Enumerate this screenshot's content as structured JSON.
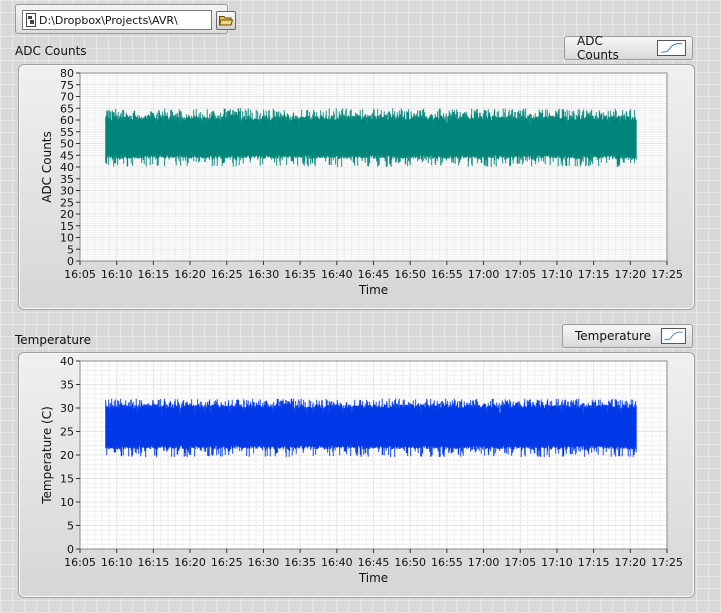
{
  "path": {
    "value": "D:\\Dropbox\\Projects\\AVR\\",
    "file_icon": "file-path-icon",
    "browse_icon": "folder-open-icon"
  },
  "colors": {
    "adc_series": "#00857a",
    "temp_series": "#0038e6",
    "plot_bg": "#ffffff",
    "grid": "#e4e4e4"
  },
  "chart_data": [
    {
      "type": "area",
      "title": "ADC Counts",
      "xlabel": "Time",
      "ylabel": "ADC Counts",
      "ylim": [
        0,
        80
      ],
      "yticks": [
        "0",
        "5",
        "10",
        "15",
        "20",
        "25",
        "30",
        "35",
        "40",
        "45",
        "50",
        "55",
        "60",
        "65",
        "70",
        "75",
        "80"
      ],
      "xticks": [
        "16:05",
        "16:10",
        "16:15",
        "16:20",
        "16:25",
        "16:30",
        "16:35",
        "16:40",
        "16:45",
        "16:50",
        "16:55",
        "17:00",
        "17:05",
        "17:10",
        "17:15",
        "17:20",
        "17:25"
      ],
      "xlim": [
        "16:05",
        "17:25"
      ],
      "grid": true,
      "legend": "top-right",
      "series": [
        {
          "name": "ADC Counts",
          "x_start": "16:08:30",
          "x_end": "17:20:50",
          "typical_range": [
            45,
            60
          ],
          "min": 40,
          "max": 65
        }
      ]
    },
    {
      "type": "area",
      "title": "Temperature",
      "xlabel": "Time",
      "ylabel": "Temperature (C)",
      "ylim": [
        0,
        40
      ],
      "yticks": [
        "0",
        "5",
        "10",
        "15",
        "20",
        "25",
        "30",
        "35",
        "40"
      ],
      "xticks": [
        "16:05",
        "16:10",
        "16:15",
        "16:20",
        "16:25",
        "16:30",
        "16:35",
        "16:40",
        "16:45",
        "16:50",
        "16:55",
        "17:00",
        "17:05",
        "17:10",
        "17:15",
        "17:20",
        "17:25"
      ],
      "xlim": [
        "16:05",
        "17:25"
      ],
      "grid": true,
      "legend": "top-right",
      "series": [
        {
          "name": "Temperature",
          "x_start": "16:08:30",
          "x_end": "17:20:50",
          "typical_range": [
            22,
            30
          ],
          "min": 19.5,
          "max": 32
        }
      ]
    }
  ]
}
